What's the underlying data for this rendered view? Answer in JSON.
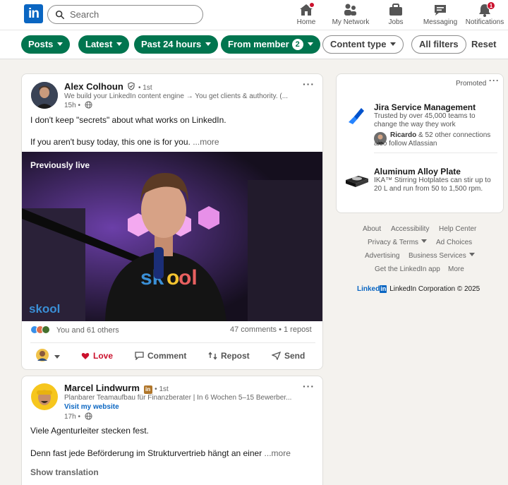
{
  "nav": {
    "search_placeholder": "Search",
    "items": [
      {
        "label": "Home",
        "icon": "home-icon",
        "badge": ""
      },
      {
        "label": "My Network",
        "icon": "network-icon",
        "badge": ""
      },
      {
        "label": "Jobs",
        "icon": "jobs-icon",
        "badge": ""
      },
      {
        "label": "Messaging",
        "icon": "messaging-icon",
        "badge": ""
      },
      {
        "label": "Notifications",
        "icon": "bell-icon",
        "badge": "1"
      }
    ]
  },
  "filters": {
    "posts": "Posts",
    "latest": "Latest",
    "past24": "Past 24 hours",
    "from_member": "From member",
    "from_member_count": "2",
    "content_type": "Content type",
    "all_filters": "All filters",
    "reset": "Reset"
  },
  "post1": {
    "author": "Alex Colhoun",
    "degree": "• 1st",
    "headline": "We build your LinkedIn content engine → You get clients & authority. (...",
    "time": "15h •",
    "line1": "I don't keep \"secrets\" about what works on LinkedIn.",
    "line2": "If you aren't busy today, this one is for you.",
    "more": "...more",
    "video_label": "Previously live",
    "reactions": "You and 61 others",
    "comments": "47 comments • 1 repost",
    "actions": {
      "love": "Love",
      "comment": "Comment",
      "repost": "Repost",
      "send": "Send"
    }
  },
  "post2": {
    "author": "Marcel Lindwurm",
    "degree": "• 1st",
    "headline": "Planbarer Teamaufbau für Finanzberater | In 6 Wochen 5–15 Bewerber...",
    "website": "Visit my website",
    "time": "17h •",
    "line1": "Viele Agenturleiter stecken fest.",
    "line2": "Denn fast jede Beförderung im Strukturvertrieb hängt an einer",
    "more": "...more",
    "translate": "Show translation"
  },
  "promoted": {
    "label": "Promoted",
    "ad1": {
      "title": "Jira Service Management",
      "text1": "Trusted by over 45,000 teams to",
      "text2": "change the way they work",
      "social_name": "Ricardo",
      "social_rest": "& 52 other connections",
      "social_rest2": "also follow Atlassian"
    },
    "ad2": {
      "title": "Aluminum Alloy Plate",
      "text1": "IKA™ Stirring Hotplates can stir up to",
      "text2": "20 L and run from 50 to 1,500 rpm."
    }
  },
  "footer": {
    "about": "About",
    "accessibility": "Accessibility",
    "help": "Help Center",
    "privacy": "Privacy & Terms",
    "ad_choices": "Ad Choices",
    "advertising": "Advertising",
    "business": "Business Services",
    "app": "Get the LinkedIn app",
    "more": "More",
    "brand": "Linked",
    "corp": "LinkedIn Corporation © 2025"
  },
  "colors": {
    "brand": "#0a66c2",
    "accent_green": "#01754f",
    "love": "#cb112d"
  }
}
